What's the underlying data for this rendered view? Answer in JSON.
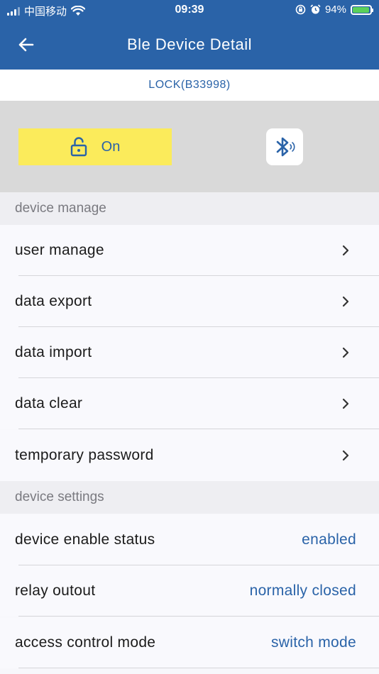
{
  "status_bar": {
    "carrier": "中国移动",
    "time": "09:39",
    "battery": "94%",
    "battery_level": 0.94,
    "icons": [
      "signal-icon",
      "wifi-icon",
      "orientation-lock-icon",
      "alarm-icon",
      "battery-icon"
    ]
  },
  "header": {
    "title": "Ble Device Detail",
    "back_icon": "arrow-left-icon"
  },
  "device": {
    "name": "LOCK(B33998)"
  },
  "controls": {
    "lock_label": "On",
    "lock_icon": "lock-open-icon",
    "ble_icon": "bluetooth-icon",
    "lock_bg": "#fbeb5b",
    "accent": "#2a63a8"
  },
  "sections": {
    "manage": {
      "title": "device manage",
      "items": [
        {
          "label": "user manage"
        },
        {
          "label": "data export"
        },
        {
          "label": "data import"
        },
        {
          "label": "data clear"
        },
        {
          "label": "temporary password"
        }
      ]
    },
    "settings": {
      "title": "device settings",
      "items": [
        {
          "label": "device enable status",
          "value": "enabled"
        },
        {
          "label": "relay outout",
          "value": "normally closed"
        },
        {
          "label": "access control mode",
          "value": "switch mode"
        }
      ]
    }
  }
}
